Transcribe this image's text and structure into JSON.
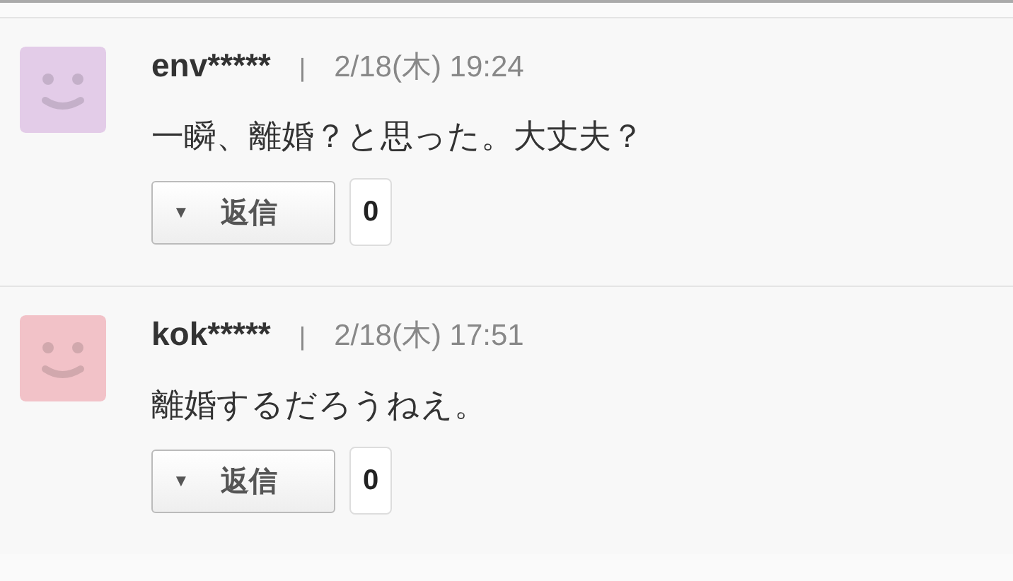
{
  "comments": [
    {
      "color": "#e3cce8",
      "user": "env*****",
      "separator": "|",
      "date": "2/18(木) 19:24",
      "body": "一瞬、離婚？と思った。大丈夫？",
      "reply_caret": "▼",
      "reply_label": "返信",
      "reply_count": "0"
    },
    {
      "color": "#f2c2c8",
      "user": "kok*****",
      "separator": "|",
      "date": "2/18(木) 17:51",
      "body": "離婚するだろうねえ。",
      "reply_caret": "▼",
      "reply_label": "返信",
      "reply_count": "0"
    }
  ]
}
